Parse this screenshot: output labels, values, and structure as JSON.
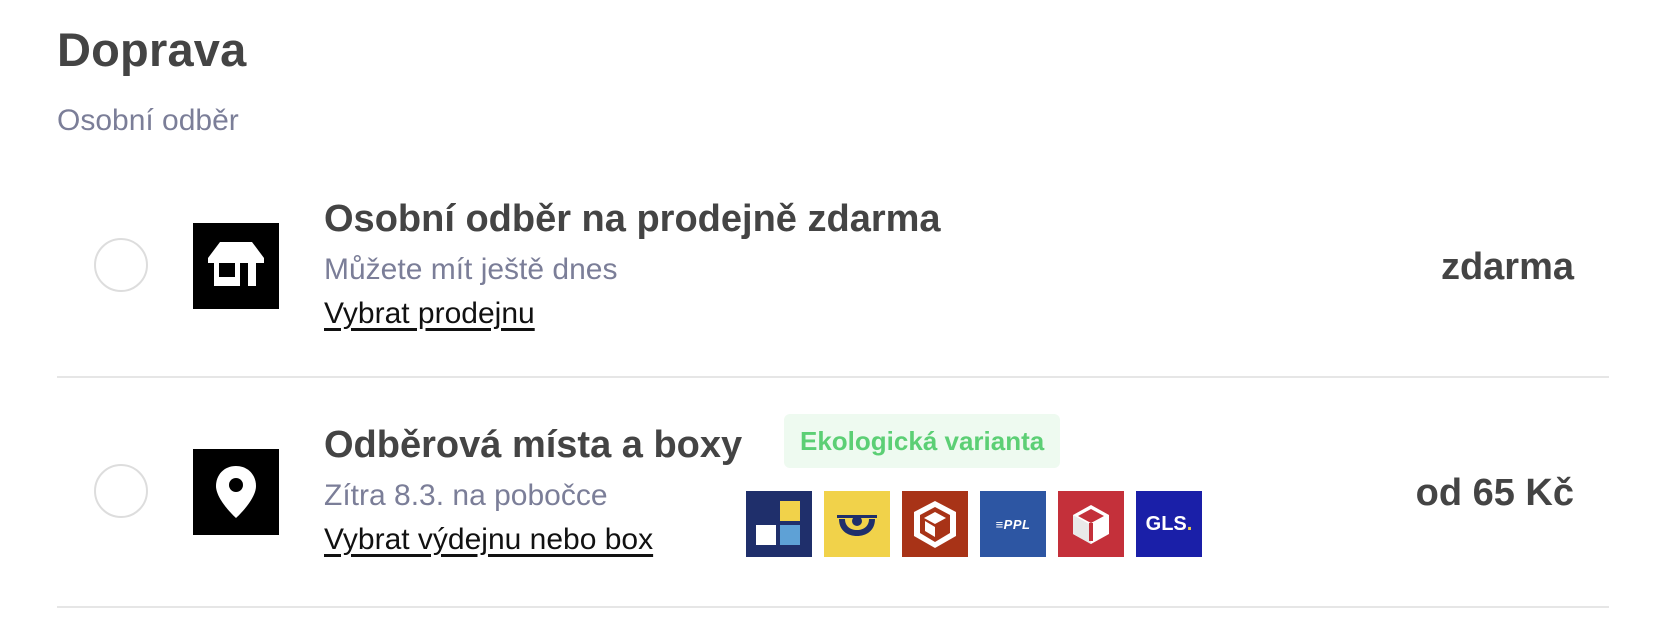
{
  "shipping": {
    "title": "Doprava",
    "subtitle": "Osobní odběr",
    "methods": [
      {
        "name": "Osobní odběr na prodejně zdarma",
        "note": "Můžete mít ještě dnes",
        "link": "Vybrat prodejnu",
        "price": "zdarma",
        "icon": "store-icon",
        "selected": false
      },
      {
        "name": "Odběrová místa a boxy",
        "badge": "Ekologická varianta",
        "note": "Zítra 8.3. na pobočce",
        "link": "Vybrat výdejnu nebo box",
        "price": "od 65 Kč",
        "icon": "map-pin-icon",
        "selected": false,
        "carriers": [
          {
            "name": "pickup-box-logo"
          },
          {
            "name": "ceska-posta-logo"
          },
          {
            "name": "balik-logo"
          },
          {
            "name": "ppl-logo",
            "text": "≡PPL"
          },
          {
            "name": "dpd-logo"
          },
          {
            "name": "gls-logo",
            "text": "GLS",
            "dot": "."
          }
        ]
      }
    ]
  },
  "colors": {
    "text_dark": "#444444",
    "text_muted": "#7b7e98",
    "badge_bg": "#eefaf0",
    "badge_text": "#5ccf75",
    "divider": "#e6e6e6"
  }
}
